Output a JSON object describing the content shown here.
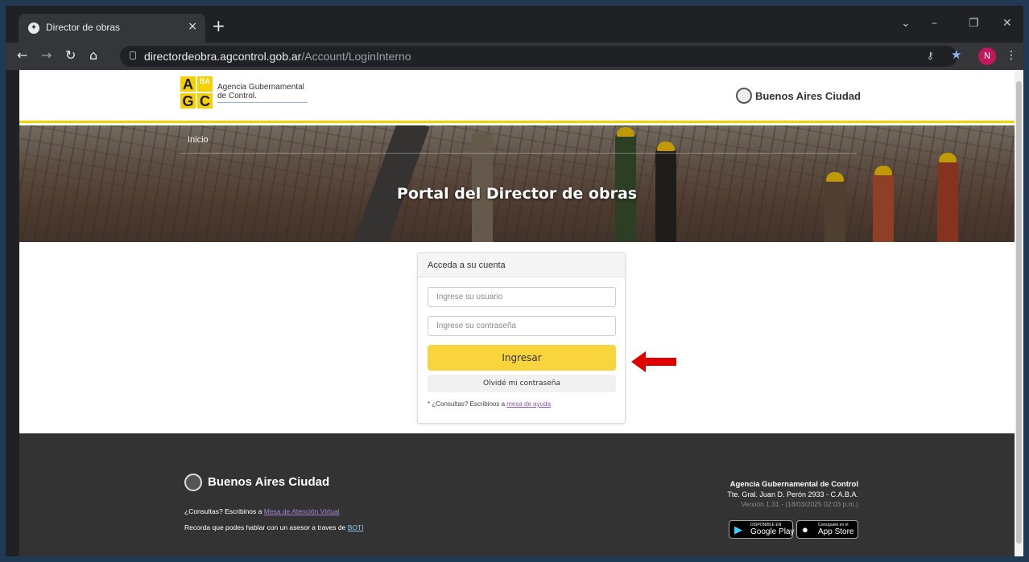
{
  "browser": {
    "tab_title": "Director de obras",
    "tab_close": "×",
    "new_tab": "+",
    "url_domain": "directordeobra.agcontrol.gob.ar",
    "url_path": "/Account/LoginInterno",
    "profile_initial": "N",
    "controls": {
      "dropdown": "⌄",
      "minimize": "–",
      "restore": "❐",
      "close": "✕"
    }
  },
  "header": {
    "agc_letters": [
      "A",
      "BA",
      "G",
      "C"
    ],
    "agc_name_line1": "Agencia Gubernamental",
    "agc_name_line2": "de Control.",
    "ba_brand": "Buenos Aires Ciudad"
  },
  "hero": {
    "nav_home": "Inicio",
    "title": "Portal del Director de obras"
  },
  "login": {
    "card_title": "Acceda a su cuenta",
    "username_placeholder": "Ingrese su usuario",
    "password_placeholder": "Ingrese su contraseña",
    "submit_label": "Ingresar",
    "forgot_label": "Olvidé mi contraseña",
    "help_prefix": "* ¿Consultas? Escribinos a ",
    "help_link": "mesa de ayuda"
  },
  "footer": {
    "brand": "Buenos Aires Ciudad",
    "consult_prefix": "¿Consultas? Escribinos a ",
    "consult_link": "Mesa de Atención Virtual",
    "boti_prefix": "Recorda que podes hablar con un asesor a traves de ",
    "boti_link": "BOTI",
    "org_name": "Agencia Gubernamental de Control",
    "address": "Tte. Gral. Juan D. Perón 2933 - C.A.B.A.",
    "version": "Versión 1.31 - (18/03/2025 02:03 p.m.)",
    "google_play_small": "DISPONIBLE EN",
    "google_play_big": "Google Play",
    "app_store_small": "Consíguelo en el",
    "app_store_big": "App Store"
  },
  "colors": {
    "accent_yellow": "#f9d43c",
    "footer_bg": "#333333",
    "annotation_red": "#e00000"
  }
}
